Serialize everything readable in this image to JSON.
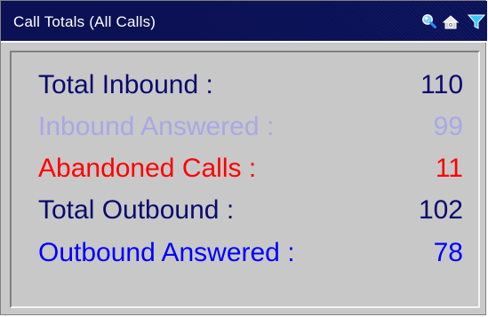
{
  "window": {
    "title": "Call Totals (All Calls)",
    "icons": [
      "search-icon",
      "settings-icon",
      "filter-icon"
    ]
  },
  "stats": [
    {
      "label": "Total Inbound :",
      "value": "110",
      "color": "#0a0a6e"
    },
    {
      "label": "Inbound Answered :",
      "value": "99",
      "color": "#a8a8e6"
    },
    {
      "label": "Abandoned Calls :",
      "value": "11",
      "color": "#ff0000"
    },
    {
      "label": "Total Outbound :",
      "value": "102",
      "color": "#0a0a6e"
    },
    {
      "label": "Outbound Answered :",
      "value": "78",
      "color": "#0000ff"
    }
  ],
  "colors": {
    "titlebar": "#0b1154",
    "panel_background": "#c8c8c8"
  }
}
